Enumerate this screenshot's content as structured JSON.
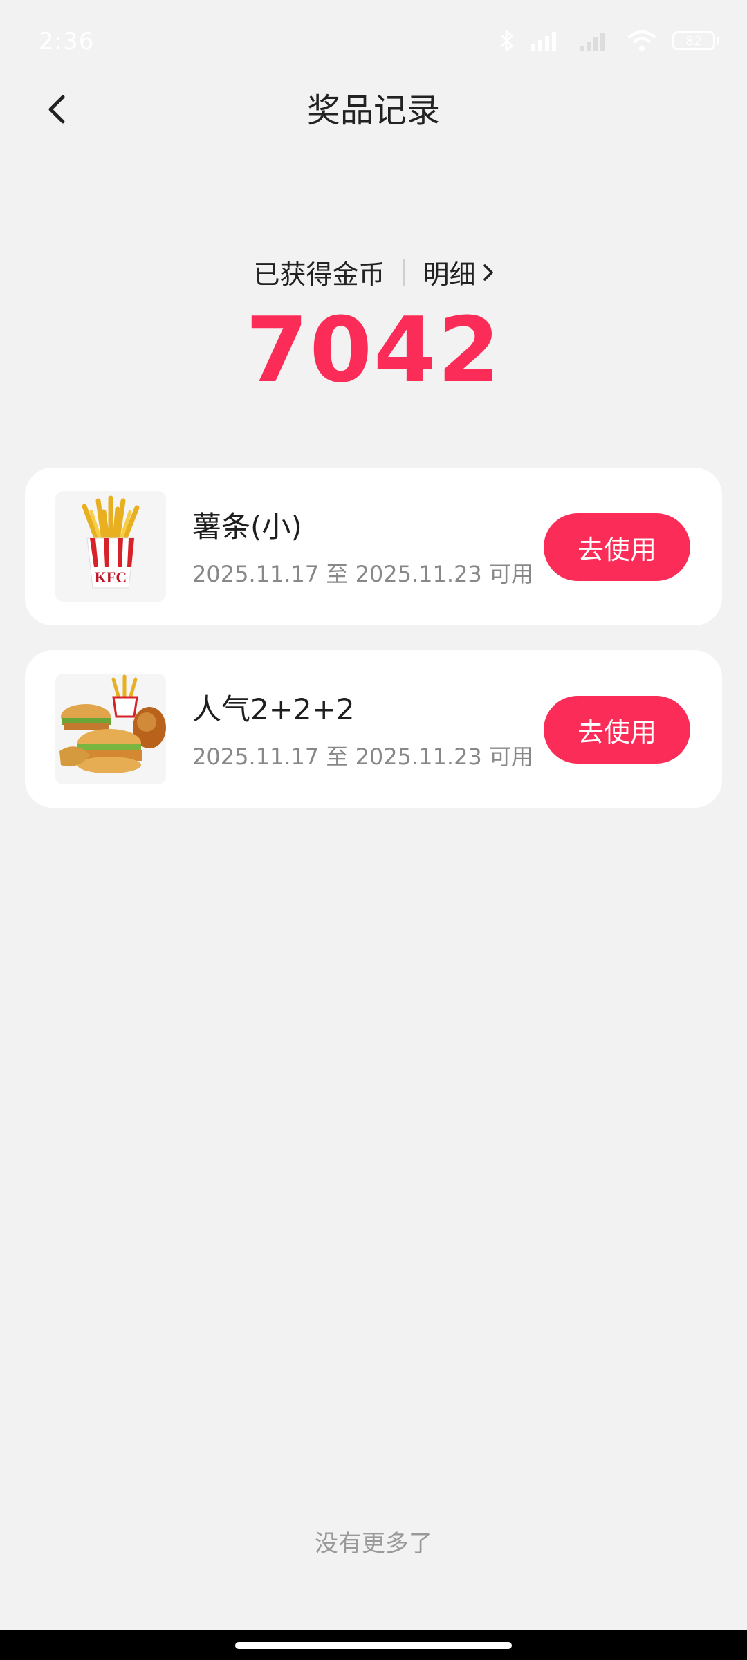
{
  "status_bar": {
    "time": "2:36",
    "battery": "82"
  },
  "header": {
    "title": "奖品记录"
  },
  "summary": {
    "label": "已获得金币",
    "detail_label": "明细",
    "coins": "7042"
  },
  "prizes": [
    {
      "name": "薯条(小)",
      "validity": "2025.11.17 至 2025.11.23 可用",
      "button_label": "去使用",
      "image_icon": "fries-image"
    },
    {
      "name": "人气2+2+2",
      "validity": "2025.11.17 至 2025.11.23 可用",
      "button_label": "去使用",
      "image_icon": "combo-meal-image"
    }
  ],
  "footer": {
    "end_text": "没有更多了"
  },
  "colors": {
    "accent": "#fb2c57",
    "background": "#f2f2f2"
  }
}
